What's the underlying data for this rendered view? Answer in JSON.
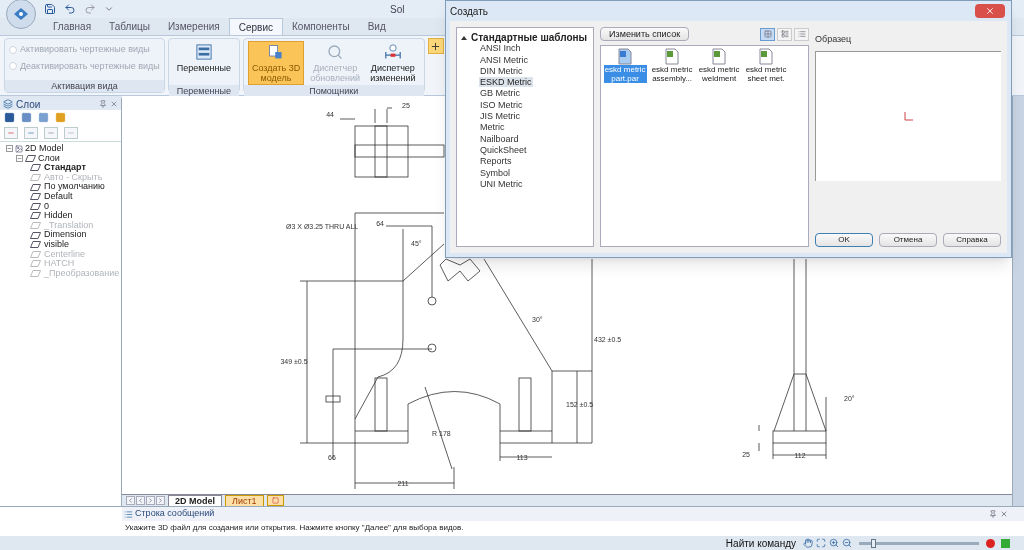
{
  "app": {
    "title": "Sol"
  },
  "ribbon_tabs": [
    {
      "label": "Главная",
      "selected": false
    },
    {
      "label": "Таблицы",
      "selected": false
    },
    {
      "label": "Измерения",
      "selected": false
    },
    {
      "label": "Сервис",
      "selected": true
    },
    {
      "label": "Компоненты",
      "selected": false
    },
    {
      "label": "Вид",
      "selected": false
    }
  ],
  "ribbon_groups": [
    {
      "label": "Активация вида",
      "kind": "checks",
      "items": [
        {
          "label": "Активировать чертежные виды",
          "disabled": true
        },
        {
          "label": "Деактивировать чертежные виды",
          "disabled": true
        }
      ]
    },
    {
      "label": "Переменные",
      "kind": "buttons",
      "items": [
        {
          "label": "Переменные",
          "disabled": false,
          "selected": false
        }
      ]
    },
    {
      "label": "Помощники",
      "kind": "buttons",
      "items": [
        {
          "label": "Создать 3D модель",
          "disabled": false,
          "selected": true
        },
        {
          "label": "Диспетчер обновлений",
          "disabled": true,
          "selected": false
        },
        {
          "label": "Диспетчер изменений",
          "disabled": false,
          "selected": false
        }
      ]
    }
  ],
  "layers_panel": {
    "title": "Слои",
    "tree": {
      "label": "2D Model",
      "children": [
        {
          "label": "Слои",
          "children": [
            {
              "label": "Стандарт",
              "active": true,
              "hidden": false
            },
            {
              "label": "Авто - Скрыть",
              "active": false,
              "hidden": true
            },
            {
              "label": "По умолчанию",
              "active": false,
              "hidden": false
            },
            {
              "label": "Default",
              "active": false,
              "hidden": false
            },
            {
              "label": "0",
              "active": false,
              "hidden": false
            },
            {
              "label": "Hidden",
              "active": false,
              "hidden": false
            },
            {
              "label": "_Translation",
              "active": false,
              "hidden": true
            },
            {
              "label": "Dimension",
              "active": false,
              "hidden": false
            },
            {
              "label": "visible",
              "active": false,
              "hidden": false
            },
            {
              "label": "Centerline",
              "active": false,
              "hidden": true
            },
            {
              "label": "HATCH",
              "active": false,
              "hidden": true
            },
            {
              "label": "_Преобразование",
              "active": false,
              "hidden": true
            }
          ]
        }
      ]
    }
  },
  "drawing_labels": [
    "44",
    "25",
    "Ø3 X Ø3.25 THRU ALL",
    "64",
    "45°",
    "30°",
    "349 ±0.5",
    "432 ±0.5",
    "152 ±0.5",
    "R 178",
    "66",
    "211",
    "113",
    "20°",
    "25",
    "112"
  ],
  "sheet_tabs": [
    {
      "label": "2D Model",
      "selected": true
    },
    {
      "label": "Лист1",
      "selected": false
    }
  ],
  "message_bar": {
    "title": "Строка сообщений",
    "text": "Укажите 3D файл для создания или открытия. Нажмите кнопку \"Далее\" для выбора видов."
  },
  "status_bar": {
    "find_command": "Найти команду",
    "zoom": {
      "level": 0.12
    }
  },
  "dialog": {
    "title": "Создать",
    "tree": {
      "label": "Стандартные шаблоны",
      "expanded": true,
      "children": [
        {
          "label": "ANSI Inch",
          "selected": false
        },
        {
          "label": "ANSI Metric",
          "selected": false
        },
        {
          "label": "DIN Metric",
          "selected": false
        },
        {
          "label": "ESKD Metric",
          "selected": true
        },
        {
          "label": "GB Metric",
          "selected": false
        },
        {
          "label": "ISO Metric",
          "selected": false
        },
        {
          "label": "JIS Metric",
          "selected": false
        },
        {
          "label": "Metric",
          "selected": false
        },
        {
          "label": "Nailboard",
          "selected": false
        },
        {
          "label": "QuickSheet",
          "selected": false
        },
        {
          "label": "Reports",
          "selected": false
        },
        {
          "label": "Symbol",
          "selected": false
        },
        {
          "label": "UNI Metric",
          "selected": false
        }
      ]
    },
    "edit_list_button": "Изменить список",
    "view_modes": [
      {
        "selected": true
      },
      {
        "selected": false
      },
      {
        "selected": false
      }
    ],
    "templates": [
      {
        "label": "eskd metric part.par",
        "selected": true
      },
      {
        "label": "eskd metric assembly...",
        "selected": false
      },
      {
        "label": "eskd metric weldment",
        "selected": false
      },
      {
        "label": "eskd metric sheet met.",
        "selected": false
      }
    ],
    "preview_label": "Образец",
    "buttons": [
      "OK",
      "Отмена",
      "Справка"
    ]
  }
}
